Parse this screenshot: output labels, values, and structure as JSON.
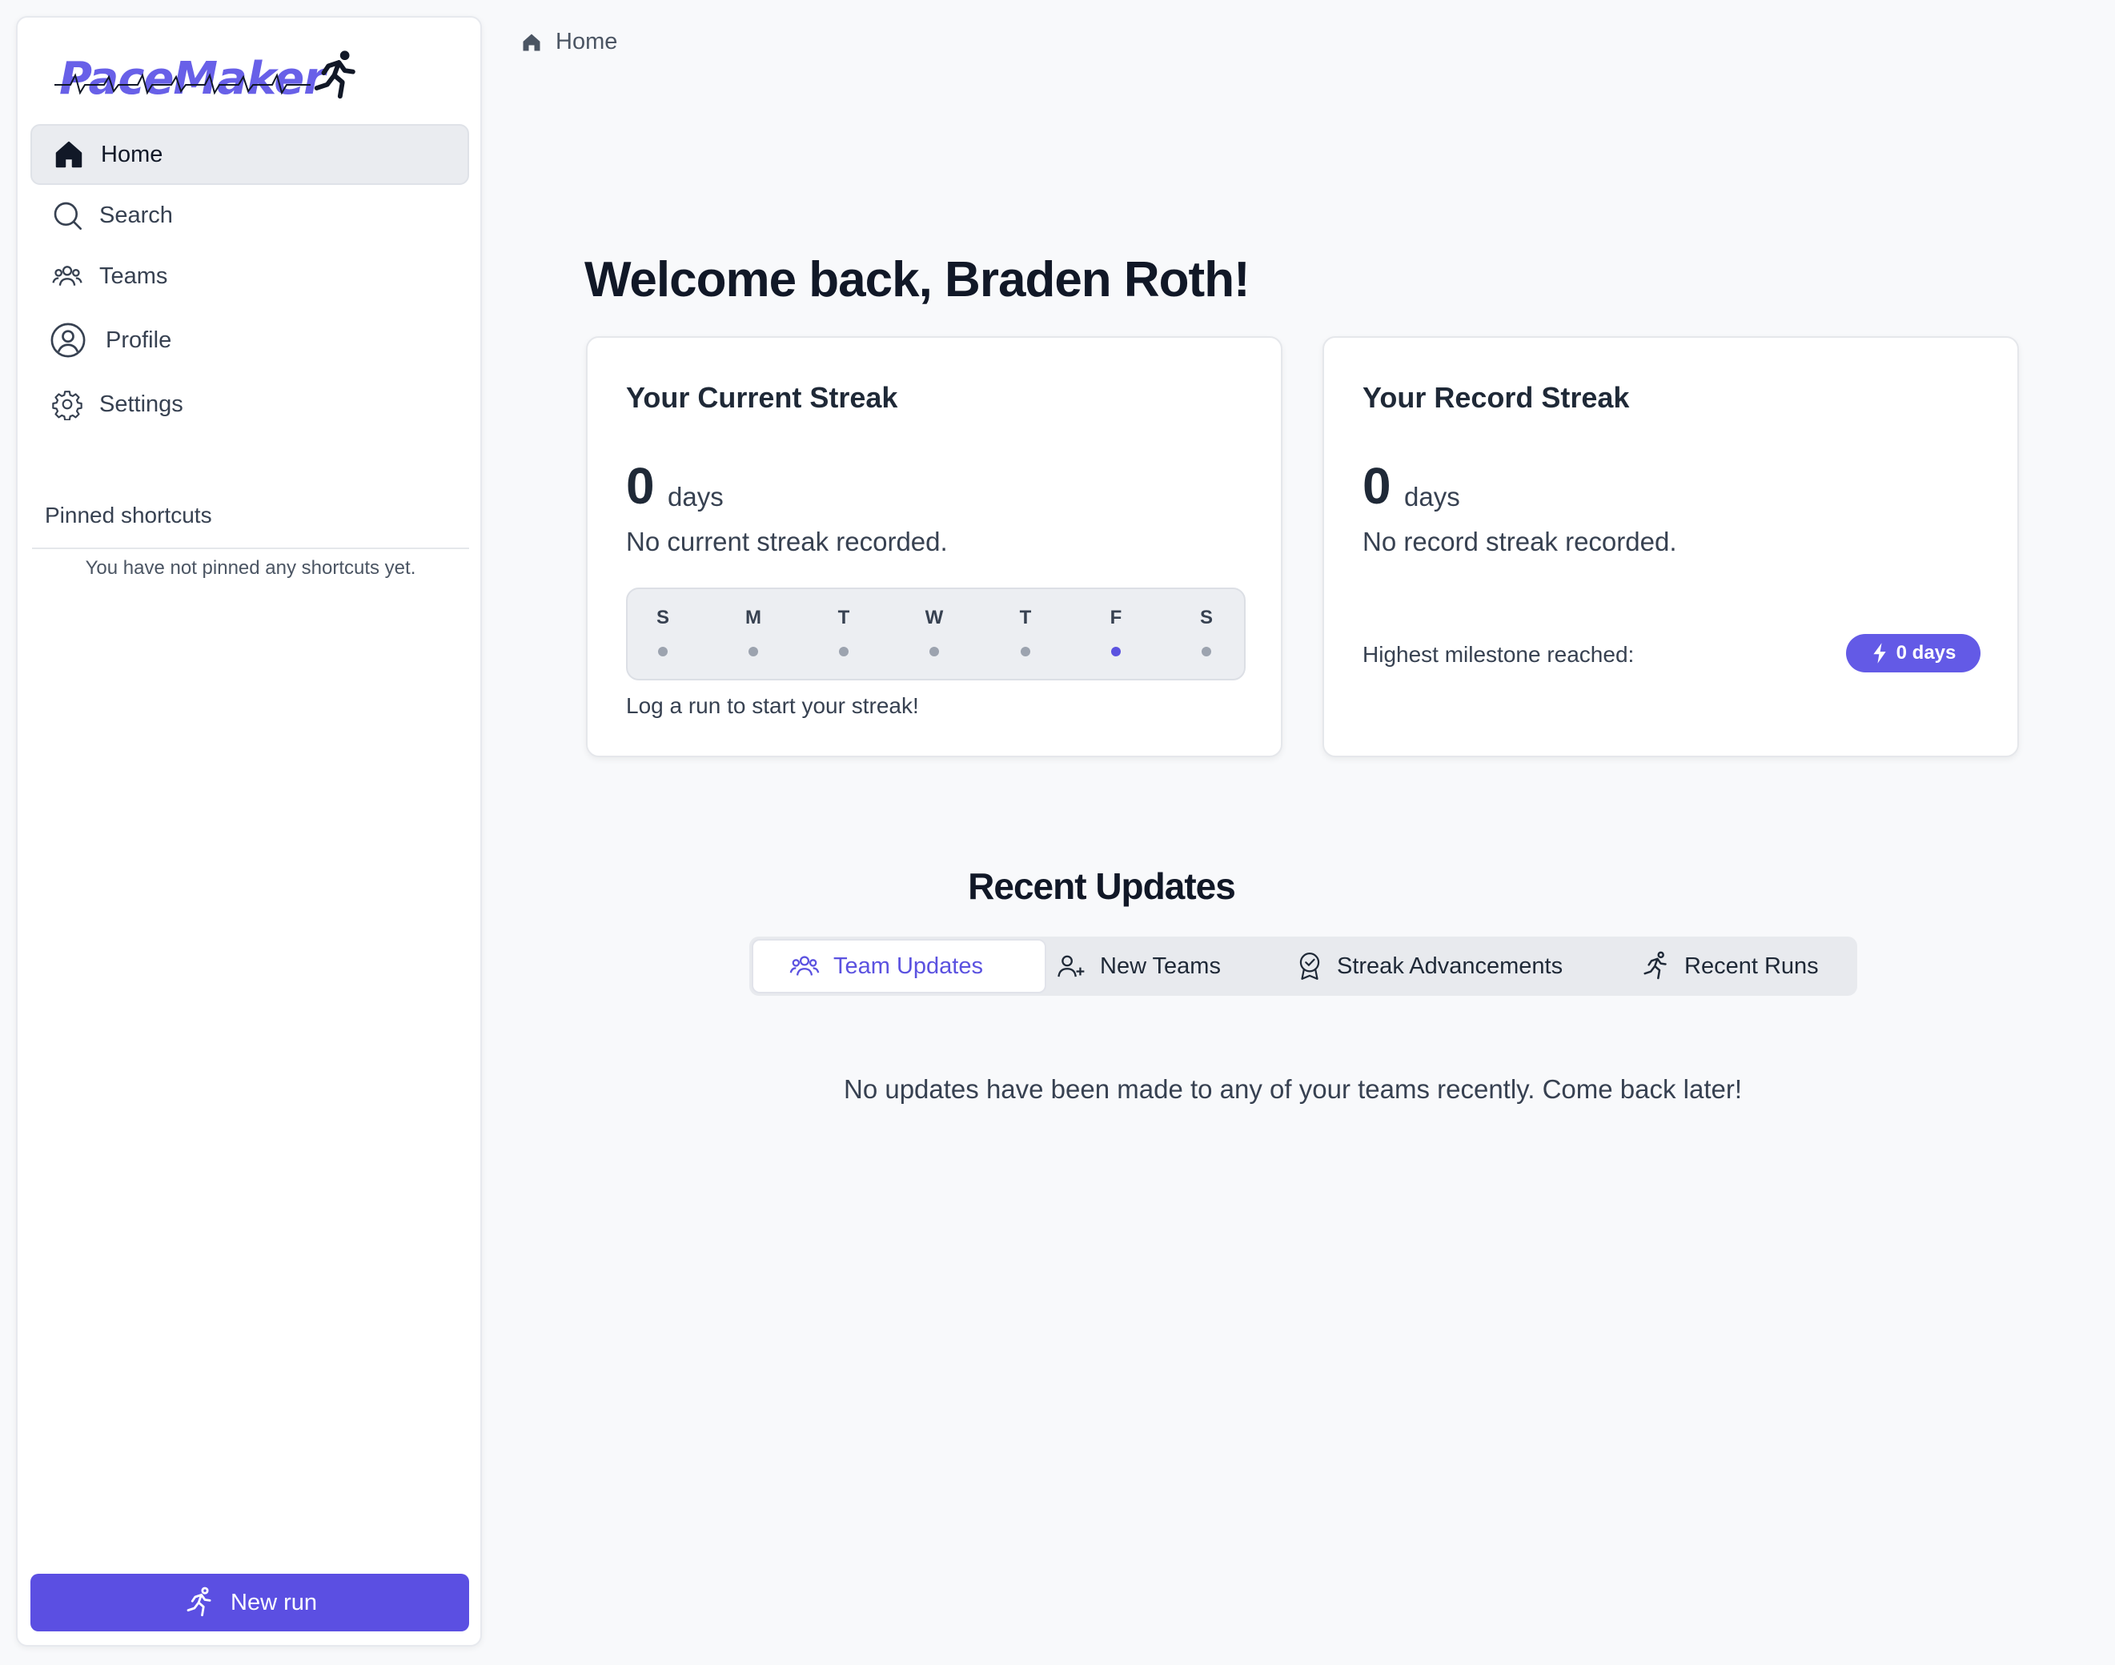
{
  "app": {
    "name": "PaceMaker"
  },
  "sidebar": {
    "items": [
      {
        "label": "Home",
        "icon": "home-icon",
        "active": true
      },
      {
        "label": "Search",
        "icon": "search-icon"
      },
      {
        "label": "Teams",
        "icon": "users-icon"
      },
      {
        "label": "Profile",
        "icon": "user-circle-icon"
      },
      {
        "label": "Settings",
        "icon": "gear-icon"
      }
    ],
    "pinned_title": "Pinned shortcuts",
    "pinned_empty": "You have not pinned any shortcuts yet.",
    "new_run_label": "New run"
  },
  "breadcrumb": {
    "label": "Home"
  },
  "welcome": "Welcome back, Braden Roth!",
  "current_streak": {
    "title": "Your Current Streak",
    "value": "0",
    "unit": "days",
    "status": "No current streak recorded.",
    "week_days": [
      "S",
      "M",
      "T",
      "W",
      "T",
      "F",
      "S"
    ],
    "today_index": 5,
    "hint": "Log a run to start your streak!"
  },
  "record_streak": {
    "title": "Your Record Streak",
    "value": "0",
    "unit": "days",
    "status": "No record streak recorded.",
    "milestone_label": "Highest milestone reached:",
    "milestone_badge": "0 days"
  },
  "recent_updates": {
    "title": "Recent Updates",
    "tabs": [
      {
        "label": "Team Updates",
        "icon": "users-icon",
        "active": true
      },
      {
        "label": "New Teams",
        "icon": "user-plus-icon"
      },
      {
        "label": "Streak Advancements",
        "icon": "award-icon"
      },
      {
        "label": "Recent Runs",
        "icon": "runner-icon"
      }
    ],
    "empty_message": "No updates have been made to any of your teams recently. Come back later!"
  },
  "colors": {
    "accent": "#5b4fe2",
    "logo": "#6860e8",
    "active_tab": "#5b52e0"
  }
}
